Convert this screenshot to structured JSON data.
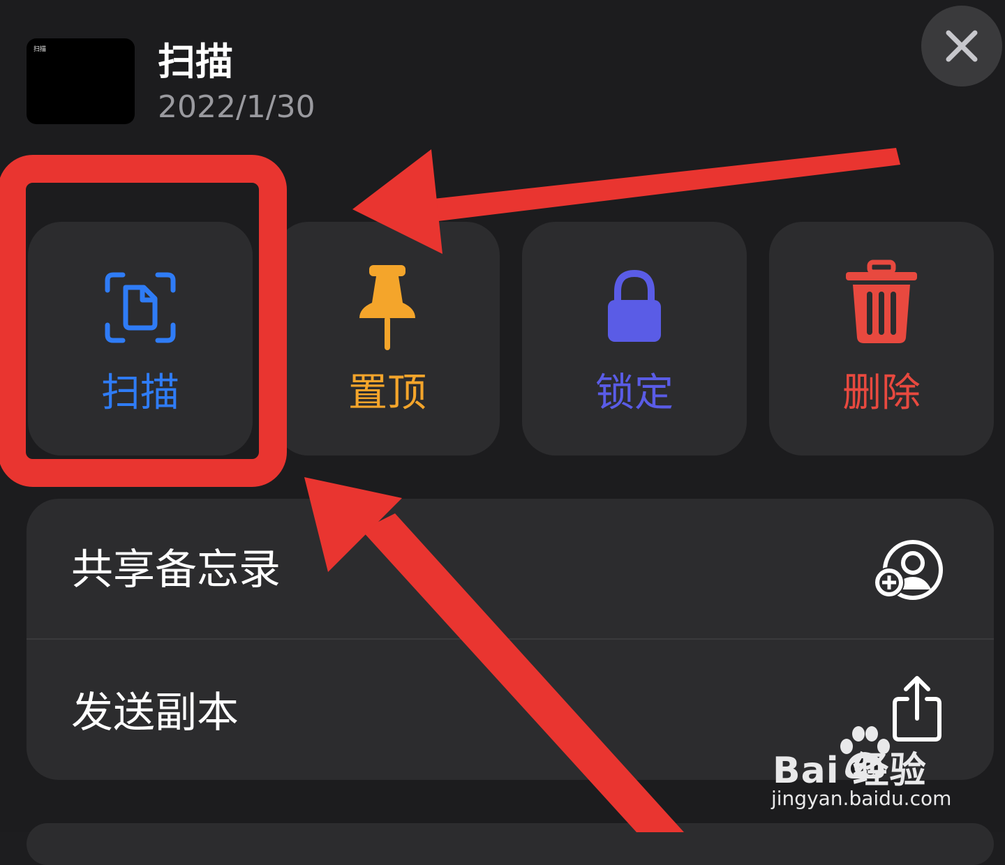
{
  "header": {
    "thumbnail_label": "扫描",
    "title": "扫描",
    "date": "2022/1/30"
  },
  "actions": [
    {
      "label": "扫描",
      "icon": "scan-document-icon",
      "color": "#2f7cf6"
    },
    {
      "label": "置顶",
      "icon": "pin-icon",
      "color": "#f4a52b"
    },
    {
      "label": "锁定",
      "icon": "lock-icon",
      "color": "#5a5ce6"
    },
    {
      "label": "删除",
      "icon": "trash-icon",
      "color": "#e8493f"
    }
  ],
  "menu": [
    {
      "label": "共享备忘录",
      "icon": "share-person-add-icon"
    },
    {
      "label": "发送副本",
      "icon": "share-upload-icon"
    }
  ],
  "annotation": {
    "color": "#e93530"
  },
  "watermark": {
    "brand": "Bai  经验",
    "url": "jingyan.baidu.com"
  }
}
